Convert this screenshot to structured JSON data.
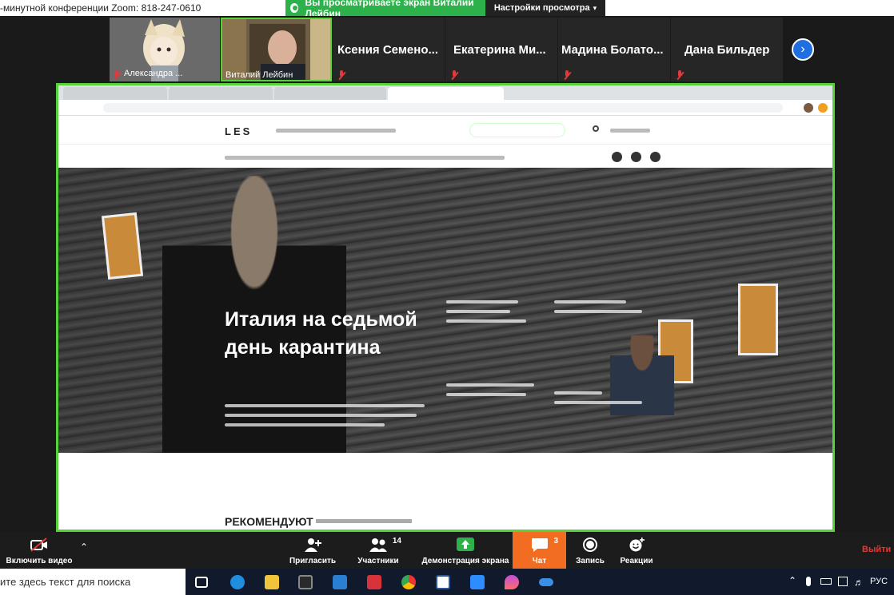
{
  "window": {
    "title": "-минутной конференции Zoom: 818-247-0610"
  },
  "share_banner": {
    "label": "Вы просматриваете экран Виталий Лейбин",
    "view_options": "Настройки просмотра"
  },
  "participants": [
    {
      "name": "Александра ...",
      "muted": true,
      "has_video": true
    },
    {
      "name": "Виталий Лейбин",
      "muted": false,
      "has_video": true
    },
    {
      "name": "Ксения  Семено...",
      "muted": true,
      "has_video": false
    },
    {
      "name": "Екатерина  Ми...",
      "muted": true,
      "has_video": false
    },
    {
      "name": "Мадина  Болато...",
      "muted": true,
      "has_video": false
    },
    {
      "name": "Дана Бильдер",
      "muted": true,
      "has_video": false
    }
  ],
  "shared_screen": {
    "site_logo": "LES",
    "hero_title": "Италия на седьмой день карантина",
    "recommend_label": "РЕКОМЕНДУЮТ"
  },
  "toolbar": {
    "video": "Включить видео",
    "invite": "Пригласить",
    "participants": "Участники",
    "participants_count": "14",
    "share": "Демонстрация экрана",
    "chat": "Чат",
    "chat_count": "3",
    "record": "Запись",
    "reactions": "Реакции",
    "exit": "Выйти"
  },
  "taskbar": {
    "search_placeholder": "ите здесь текст для поиска",
    "language": "РУС"
  },
  "colors": {
    "share_green": "#2db14a",
    "border_green": "#56d23a",
    "chat_orange": "#f26d21",
    "exit_red": "#e53935",
    "nav_blue": "#1f6fe0"
  }
}
